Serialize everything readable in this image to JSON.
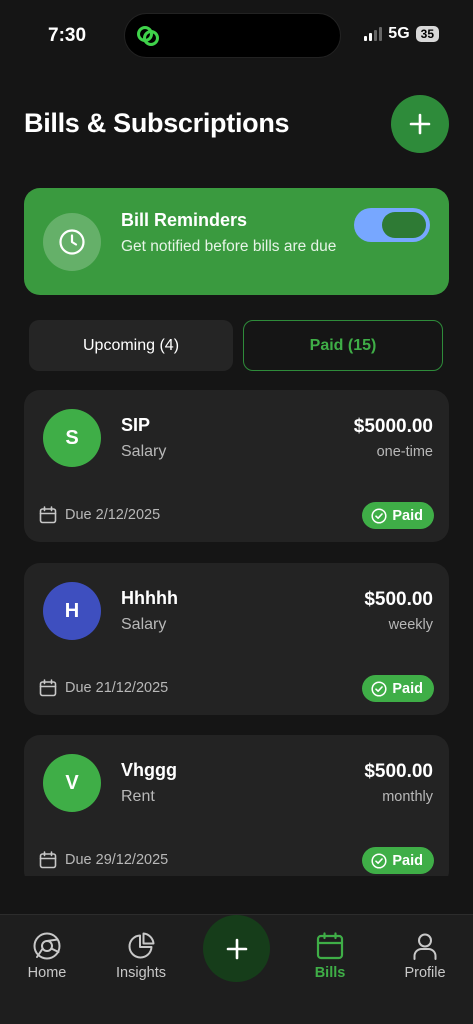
{
  "status_bar": {
    "time": "7:30",
    "network": "5G",
    "battery": "35"
  },
  "header": {
    "title": "Bills & Subscriptions",
    "add_icon": "plus-icon"
  },
  "reminder": {
    "title": "Bill Reminders",
    "subtitle": "Get notified before bills are due",
    "enabled": true,
    "icon": "clock-icon"
  },
  "tabs": [
    {
      "label": "Upcoming (4)",
      "active": false
    },
    {
      "label": "Paid (15)",
      "active": true
    }
  ],
  "bills": [
    {
      "initial": "S",
      "name": "SIP",
      "category": "Salary",
      "amount": "$5000.00",
      "frequency": "one-time",
      "due": "Due 2/12/2025",
      "status": "Paid",
      "avatar_color": "#3fae47"
    },
    {
      "initial": "H",
      "name": "Hhhhh",
      "category": "Salary",
      "amount": "$500.00",
      "frequency": "weekly",
      "due": "Due 21/12/2025",
      "status": "Paid",
      "avatar_color": "#3e4fbf"
    },
    {
      "initial": "V",
      "name": "Vhggg",
      "category": "Rent",
      "amount": "$500.00",
      "frequency": "monthly",
      "due": "Due 29/12/2025",
      "status": "Paid",
      "avatar_color": "#3fae47"
    }
  ],
  "nav": {
    "items": [
      {
        "label": "Home",
        "icon": "home-icon"
      },
      {
        "label": "Insights",
        "icon": "pie-chart-icon"
      },
      {
        "label": "Bills",
        "icon": "calendar-icon",
        "active": true
      },
      {
        "label": "Profile",
        "icon": "user-icon"
      }
    ],
    "center_icon": "plus-icon"
  },
  "colors": {
    "accent": "#3fae47",
    "accent_dark": "#2e8b3a",
    "background": "#151515",
    "card": "#232323"
  }
}
